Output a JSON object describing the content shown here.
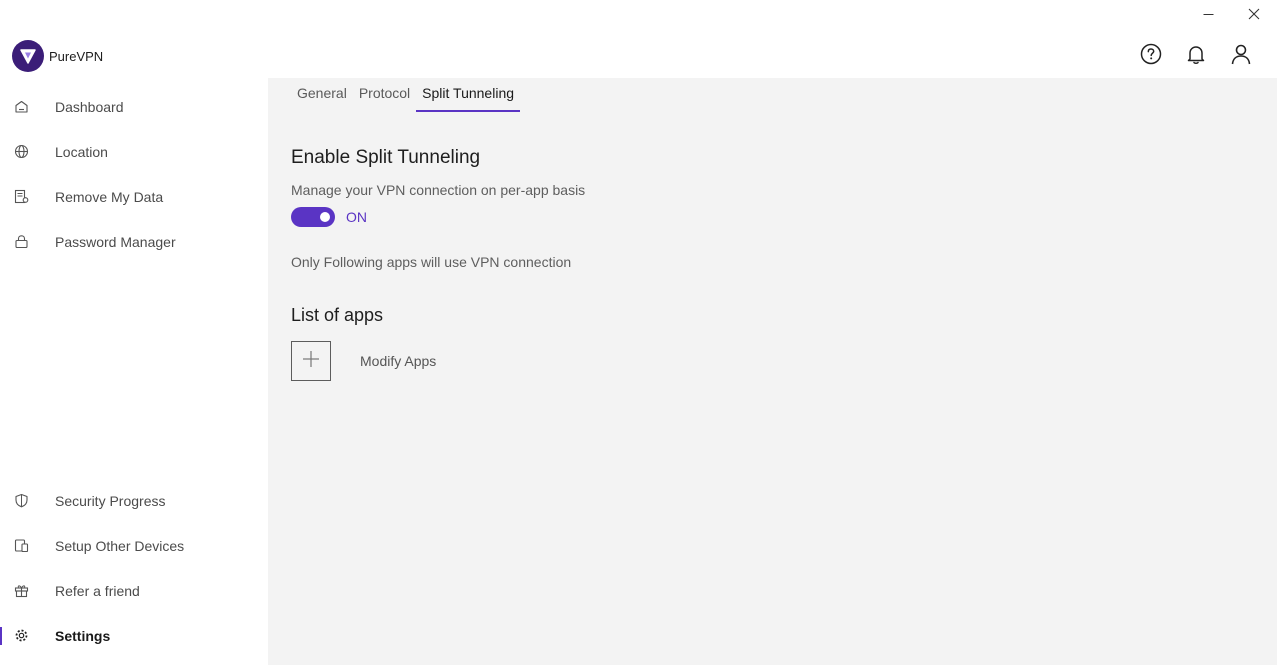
{
  "app": {
    "name": "PureVPN"
  },
  "colors": {
    "accent": "#5a34c4",
    "brand_dark": "#3b1d78",
    "content_bg": "#f3f3f3"
  },
  "window": {
    "minimize_icon": "minimize-icon",
    "close_icon": "close-icon"
  },
  "header": {
    "icons": [
      "help-icon",
      "bell-icon",
      "user-icon"
    ]
  },
  "sidebar": {
    "items": [
      {
        "label": "Dashboard",
        "icon": "home-icon"
      },
      {
        "label": "Location",
        "icon": "globe-icon"
      },
      {
        "label": "Remove My Data",
        "icon": "data-removal-icon"
      },
      {
        "label": "Password Manager",
        "icon": "lock-icon"
      }
    ],
    "bottom_items": [
      {
        "label": "Security Progress",
        "icon": "shield-icon"
      },
      {
        "label": "Setup Other Devices",
        "icon": "devices-icon"
      },
      {
        "label": "Refer a friend",
        "icon": "gift-icon"
      },
      {
        "label": "Settings",
        "icon": "gear-icon",
        "active": true
      }
    ]
  },
  "tabs": [
    {
      "label": "General"
    },
    {
      "label": "Protocol"
    },
    {
      "label": "Split Tunneling",
      "active": true
    }
  ],
  "split_tunneling": {
    "title": "Enable Split Tunneling",
    "description": "Manage your VPN connection on per-app basis",
    "toggle_state": "ON",
    "note": "Only Following apps will use VPN connection",
    "list_title": "List of apps",
    "modify_label": "Modify Apps"
  }
}
